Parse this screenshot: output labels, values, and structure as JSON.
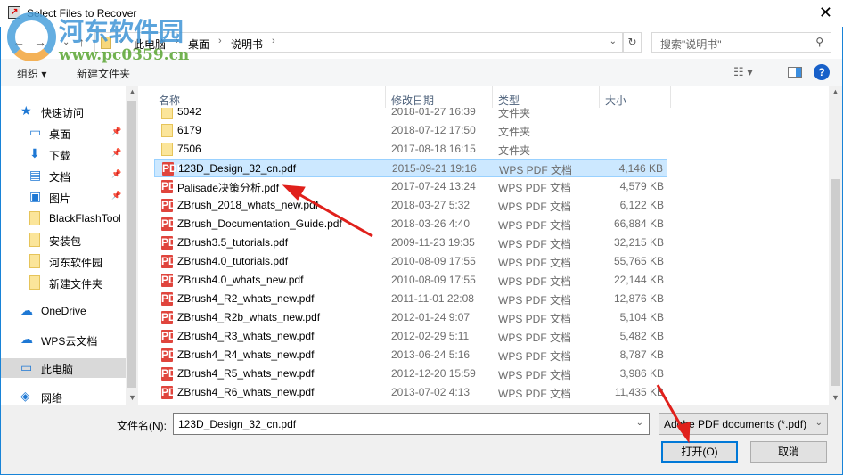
{
  "window": {
    "title": "Select Files to Recover",
    "close": "✕"
  },
  "watermark": {
    "name": "河东软件园",
    "url": "www.pc0359.cn"
  },
  "address": {
    "crumbs": [
      "此电脑",
      "桌面",
      "说明书"
    ],
    "search_placeholder": "搜索\"说明书\""
  },
  "toolbar": {
    "organize": "组织 ▾",
    "new_folder": "新建文件夹",
    "help": "?"
  },
  "nav": {
    "items": [
      {
        "label": "快速访问",
        "icon": "star-icon"
      },
      {
        "label": "桌面",
        "icon": "desktop-icon",
        "pinned": true
      },
      {
        "label": "下载",
        "icon": "download-icon",
        "pinned": true
      },
      {
        "label": "文档",
        "icon": "document-icon",
        "pinned": true
      },
      {
        "label": "图片",
        "icon": "pictures-icon",
        "pinned": true
      },
      {
        "label": "BlackFlashTool",
        "icon": "folder-icon"
      },
      {
        "label": "安装包",
        "icon": "folder-icon"
      },
      {
        "label": "河东软件园",
        "icon": "folder-icon"
      },
      {
        "label": "新建文件夹",
        "icon": "folder-icon"
      },
      {
        "label": "OneDrive",
        "icon": "cloud-icon"
      },
      {
        "label": "WPS云文档",
        "icon": "cloud-outline-icon"
      },
      {
        "label": "此电脑",
        "icon": "computer-icon",
        "selected": true
      },
      {
        "label": "网络",
        "icon": "network-icon"
      }
    ]
  },
  "columns": {
    "name": "名称",
    "date": "修改日期",
    "type": "类型",
    "size": "大小"
  },
  "files": [
    {
      "name": "5042",
      "date": "2018-01-27 16:39",
      "type": "文件夹",
      "size": "",
      "kind": "folder"
    },
    {
      "name": "6179",
      "date": "2018-07-12 17:50",
      "type": "文件夹",
      "size": "",
      "kind": "folder"
    },
    {
      "name": "7506",
      "date": "2017-08-18 16:15",
      "type": "文件夹",
      "size": "",
      "kind": "folder"
    },
    {
      "name": "123D_Design_32_cn.pdf",
      "date": "2015-09-21 19:16",
      "type": "WPS PDF 文档",
      "size": "4,146 KB",
      "kind": "pdf",
      "selected": true
    },
    {
      "name": "Palisade决策分析.pdf",
      "date": "2017-07-24 13:24",
      "type": "WPS PDF 文档",
      "size": "4,579 KB",
      "kind": "pdf"
    },
    {
      "name": "ZBrush_2018_whats_new.pdf",
      "date": "2018-03-27 5:32",
      "type": "WPS PDF 文档",
      "size": "6,122 KB",
      "kind": "pdf"
    },
    {
      "name": "ZBrush_Documentation_Guide.pdf",
      "date": "2018-03-26 4:40",
      "type": "WPS PDF 文档",
      "size": "66,884 KB",
      "kind": "pdf"
    },
    {
      "name": "ZBrush3.5_tutorials.pdf",
      "date": "2009-11-23 19:35",
      "type": "WPS PDF 文档",
      "size": "32,215 KB",
      "kind": "pdf"
    },
    {
      "name": "ZBrush4.0_tutorials.pdf",
      "date": "2010-08-09 17:55",
      "type": "WPS PDF 文档",
      "size": "55,765 KB",
      "kind": "pdf"
    },
    {
      "name": "ZBrush4.0_whats_new.pdf",
      "date": "2010-08-09 17:55",
      "type": "WPS PDF 文档",
      "size": "22,144 KB",
      "kind": "pdf"
    },
    {
      "name": "ZBrush4_R2_whats_new.pdf",
      "date": "2011-11-01 22:08",
      "type": "WPS PDF 文档",
      "size": "12,876 KB",
      "kind": "pdf"
    },
    {
      "name": "ZBrush4_R2b_whats_new.pdf",
      "date": "2012-01-24 9:07",
      "type": "WPS PDF 文档",
      "size": "5,104 KB",
      "kind": "pdf"
    },
    {
      "name": "ZBrush4_R3_whats_new.pdf",
      "date": "2012-02-29 5:11",
      "type": "WPS PDF 文档",
      "size": "5,482 KB",
      "kind": "pdf"
    },
    {
      "name": "ZBrush4_R4_whats_new.pdf",
      "date": "2013-06-24 5:16",
      "type": "WPS PDF 文档",
      "size": "8,787 KB",
      "kind": "pdf"
    },
    {
      "name": "ZBrush4_R5_whats_new.pdf",
      "date": "2012-12-20 15:59",
      "type": "WPS PDF 文档",
      "size": "3,986 KB",
      "kind": "pdf"
    },
    {
      "name": "ZBrush4_R6_whats_new.pdf",
      "date": "2013-07-02 4:13",
      "type": "WPS PDF 文档",
      "size": "11,435 KB",
      "kind": "pdf"
    }
  ],
  "footer": {
    "filename_label": "文件名(N):",
    "filename_value": "123D_Design_32_cn.pdf",
    "filetype": "Adobe PDF documents (*.pdf)",
    "open": "打开(O)",
    "cancel": "取消"
  },
  "colors": {
    "accent": "#0078d7",
    "selection": "#cce8ff",
    "arrow": "#e0201b"
  }
}
